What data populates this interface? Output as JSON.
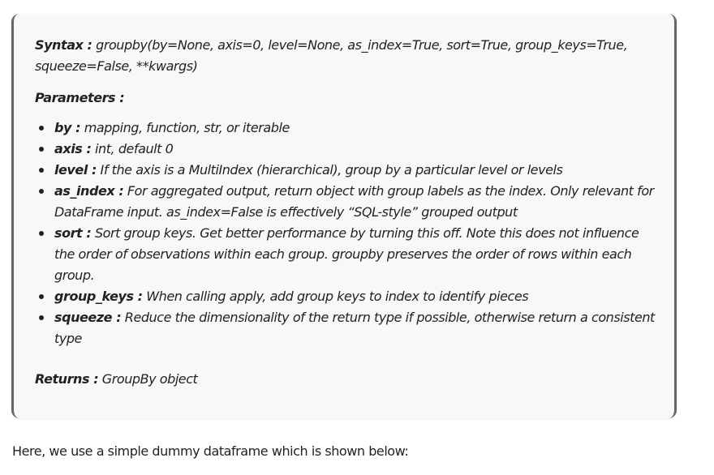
{
  "syntax": {
    "label": "Syntax :",
    "text": " groupby(by=None, axis=0, level=None, as_index=True, sort=True, group_keys=True, squeeze=False, **kwargs)"
  },
  "parameters": {
    "heading": "Parameters :",
    "items": [
      {
        "name": "by :",
        "desc": " mapping, function, str, or iterable"
      },
      {
        "name": "axis :",
        "desc": " int, default 0"
      },
      {
        "name": "level :",
        "desc": " If the axis is a MultiIndex (hierarchical), group by a particular level or levels"
      },
      {
        "name": "as_index :",
        "desc": " For aggregated output, return object with group labels as the index. Only relevant for DataFrame input. as_index=False is effectively “SQL-style” grouped output"
      },
      {
        "name": "sort :",
        "desc": " Sort group keys. Get better performance by turning this off. Note this does not influence the order of observations within each group. groupby preserves the order of rows within each group."
      },
      {
        "name": "group_keys :",
        "desc": " When calling apply, add group keys to index to identify pieces"
      },
      {
        "name": "squeeze :",
        "desc": " Reduce the dimensionality of the return type if possible, otherwise return a consistent type"
      }
    ]
  },
  "returns": {
    "label": "Returns :",
    "text": " GroupBy object"
  },
  "after_text": "Here, we use a simple dummy dataframe which is shown below:"
}
